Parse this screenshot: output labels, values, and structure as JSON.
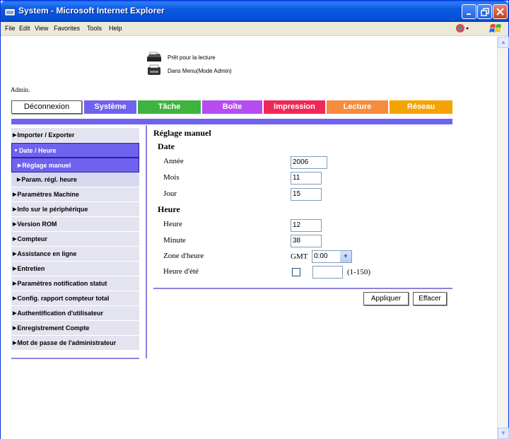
{
  "window": {
    "title": "System - Microsoft Internet Explorer"
  },
  "menu": {
    "items": [
      "File",
      "Edit",
      "View",
      "Favorites",
      "Tools",
      "Help"
    ]
  },
  "status": {
    "ready": "Prêt pour la lecture",
    "mode": "Dans Menu(Mode Admin)"
  },
  "user": {
    "label": "Admin."
  },
  "nav": {
    "logout": "Déconnexion",
    "tabs": [
      {
        "label": "Système",
        "color": "#6F62EF"
      },
      {
        "label": "Tâche",
        "color": "#3FB33F"
      },
      {
        "label": "Boîte",
        "color": "#B64CF2"
      },
      {
        "label": "Impression",
        "color": "#F0285A"
      },
      {
        "label": "Lecture",
        "color": "#F68C3C"
      },
      {
        "label": "Réseau",
        "color": "#F5A300"
      }
    ]
  },
  "sidebar": {
    "items": [
      {
        "label": "Importer / Exporter"
      },
      {
        "label": "Date / Heure"
      },
      {
        "label": "Réglage manuel"
      },
      {
        "label": "Param. régl. heure"
      },
      {
        "label": "Paramètres Machine"
      },
      {
        "label": "Info sur le périphérique"
      },
      {
        "label": "Version ROM"
      },
      {
        "label": "Compteur"
      },
      {
        "label": "Assistance en ligne"
      },
      {
        "label": "Entretien"
      },
      {
        "label": "Paramètres notification statut"
      },
      {
        "label": "Config. rapport compteur total"
      },
      {
        "label": "Authentification d'utilisateur"
      },
      {
        "label": "Enregistrement Compte"
      },
      {
        "label": "Mot de passe de l'administrateur"
      }
    ]
  },
  "form": {
    "title": "Réglage manuel",
    "date_heading": "Date",
    "year_label": "Année",
    "year_value": "2006",
    "month_label": "Mois",
    "month_value": "11",
    "day_label": "Jour",
    "day_value": "15",
    "time_heading": "Heure",
    "hour_label": "Heure",
    "hour_value": "12",
    "minute_label": "Minute",
    "minute_value": "38",
    "zone_label": "Zone d'heure",
    "zone_prefix": "GMT",
    "zone_value": "0:00",
    "dst_label": "Heure d'été",
    "dst_value": "",
    "dst_range": "(1-150)",
    "apply": "Appliquer",
    "clear": "Effacer"
  }
}
